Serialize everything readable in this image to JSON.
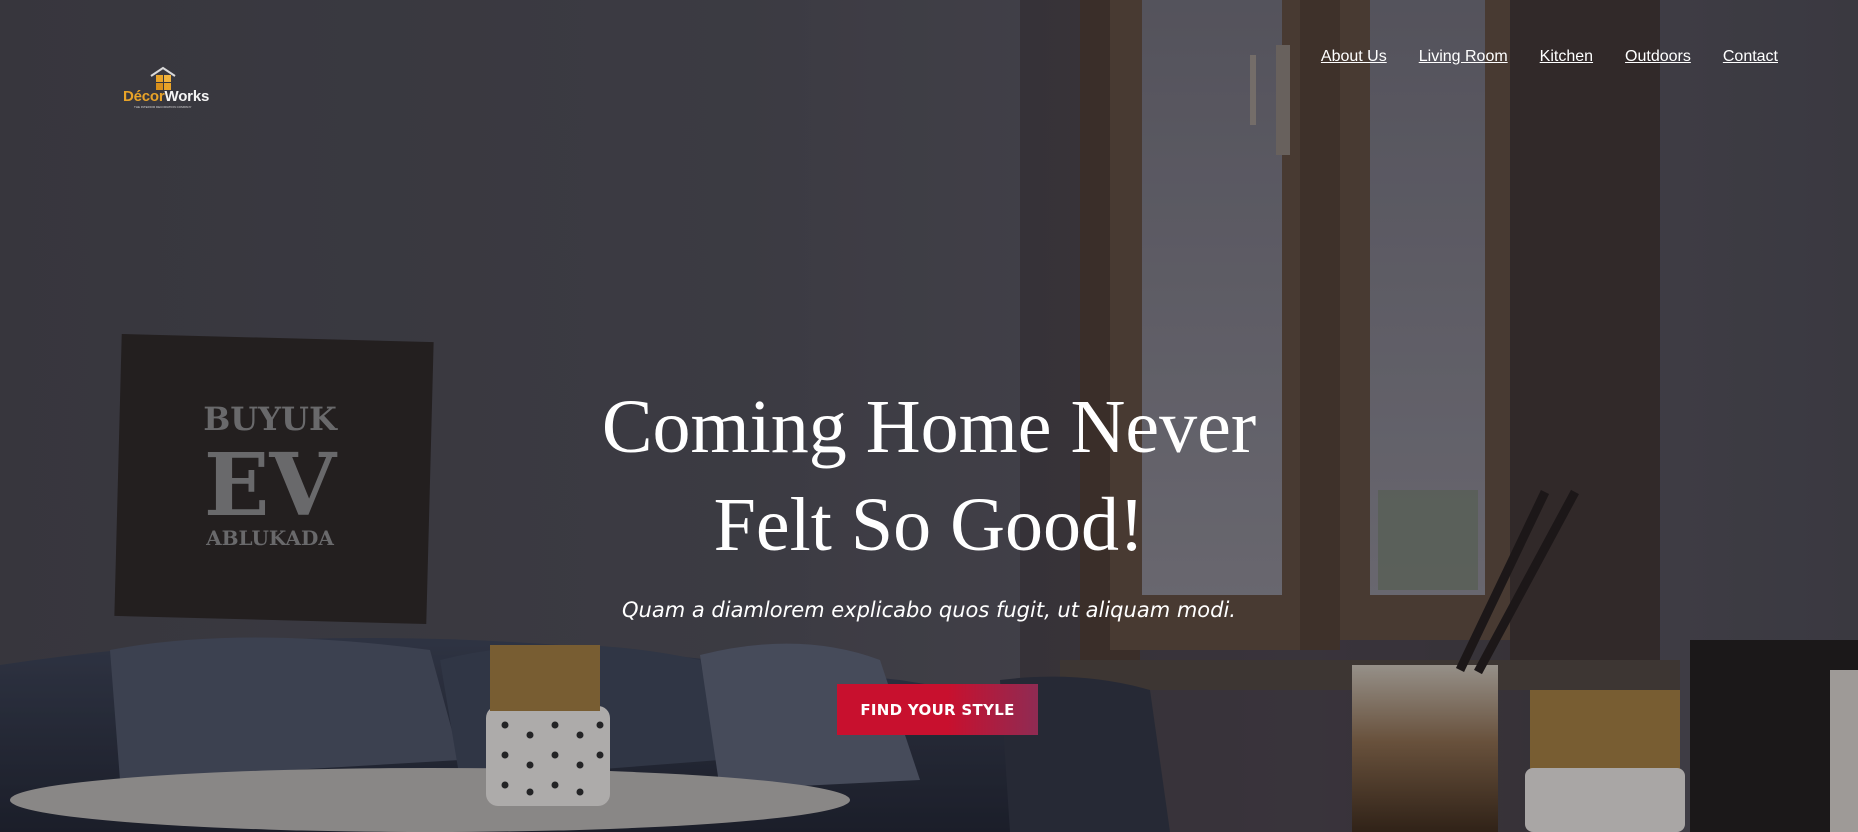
{
  "logo": {
    "text_accent": "Décor",
    "text_rest": "Works",
    "tagline": "THE INTERIOR DECORATION COMPANY"
  },
  "nav": {
    "items": [
      {
        "label": "About Us"
      },
      {
        "label": "Living Room"
      },
      {
        "label": "Kitchen"
      },
      {
        "label": "Outdoors"
      },
      {
        "label": "Contact"
      }
    ]
  },
  "hero": {
    "title_line1": "Coming Home Never",
    "title_line2": "Felt So Good!",
    "subtitle": "Quam a diamlorem explicabo quos fugit, ut aliquam modi.",
    "cta_label": "FIND YOUR STYLE",
    "poster_text": [
      "BUYUK",
      "EV",
      "ABLUKADA"
    ]
  },
  "colors": {
    "cta": "#c8102e",
    "logo_accent": "#e8a328",
    "nav_text": "#ffffff"
  }
}
